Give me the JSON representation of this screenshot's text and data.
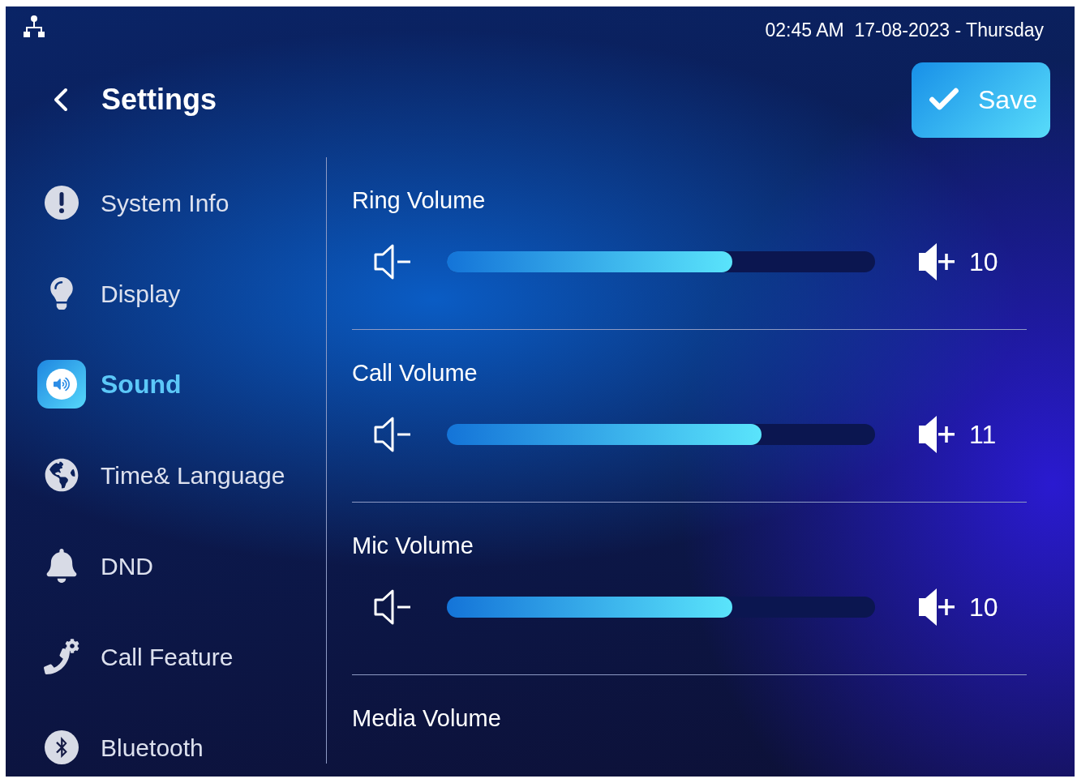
{
  "status_bar": {
    "datetime": "02:45 AM  17-08-2023 - Thursday"
  },
  "header": {
    "title": "Settings",
    "save_button": "Save"
  },
  "sidebar": {
    "items": [
      {
        "label": "System Info",
        "selected": false
      },
      {
        "label": "Display",
        "selected": false
      },
      {
        "label": "Sound",
        "selected": true
      },
      {
        "label": "Time& Language",
        "selected": false
      },
      {
        "label": "DND",
        "selected": false
      },
      {
        "label": "Call Feature",
        "selected": false
      },
      {
        "label": "Bluetooth",
        "selected": false
      }
    ]
  },
  "volumes": [
    {
      "title": "Ring Volume",
      "level": 0.667,
      "reading": "10"
    },
    {
      "title": "Call Volume",
      "level": 0.735,
      "reading": "11"
    },
    {
      "title": "Mic Volume",
      "level": 0.667,
      "reading": "10"
    },
    {
      "title": "Media Volume"
    }
  ]
}
